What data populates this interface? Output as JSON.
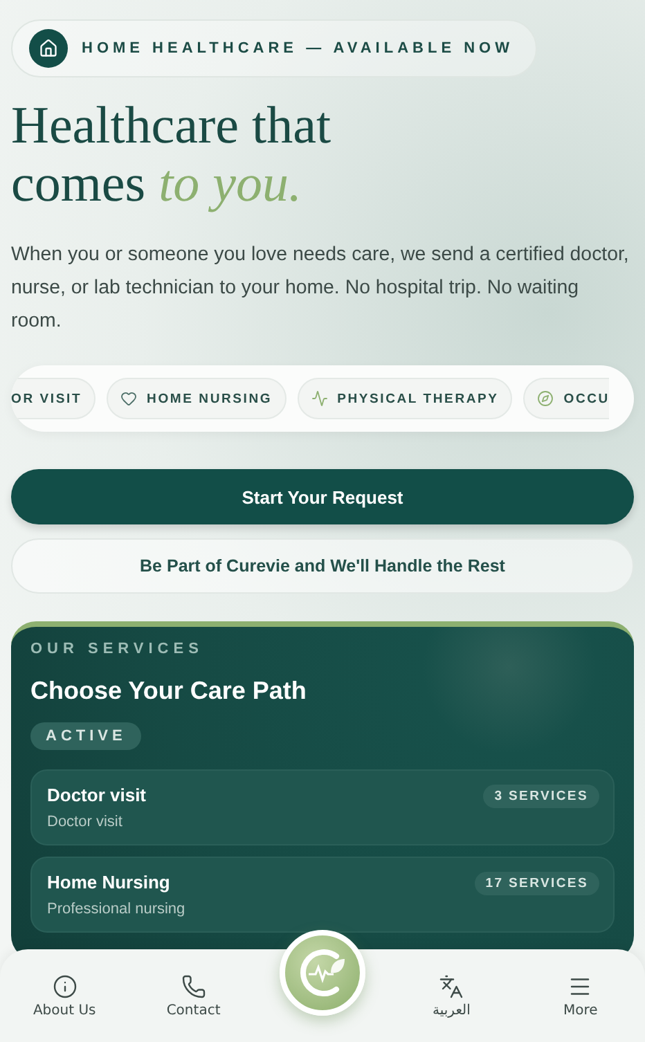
{
  "badge": {
    "text": "HOME HEALTHCARE — AVAILABLE NOW"
  },
  "hero": {
    "title_line1": "Healthcare that",
    "title_line2_plain": "comes",
    "title_line2_accent": "to you.",
    "description": "When you or someone you love needs care, we send a certified doctor, nurse, or lab technician to your home. No hospital trip. No waiting room."
  },
  "chips": [
    {
      "label": "OR VISIT"
    },
    {
      "label": "HOME NURSING"
    },
    {
      "label": "PHYSICAL THERAPY"
    },
    {
      "label": "OCCU"
    }
  ],
  "primary_button": "Start Your Request",
  "secondary_button": "Be Part of Curevie and We'll Handle the Rest",
  "services": {
    "eyebrow": "OUR SERVICES",
    "title": "Choose Your Care Path",
    "status": "ACTIVE",
    "items": [
      {
        "title": "Doctor visit",
        "subtitle": "Doctor visit",
        "count": "3 SERVICES"
      },
      {
        "title": "Home Nursing",
        "subtitle": "Professional nursing",
        "count": "17 SERVICES"
      }
    ]
  },
  "bottom_nav": [
    {
      "label": "About Us"
    },
    {
      "label": "Contact"
    },
    {
      "label": "العربية"
    },
    {
      "label": "More"
    }
  ]
}
